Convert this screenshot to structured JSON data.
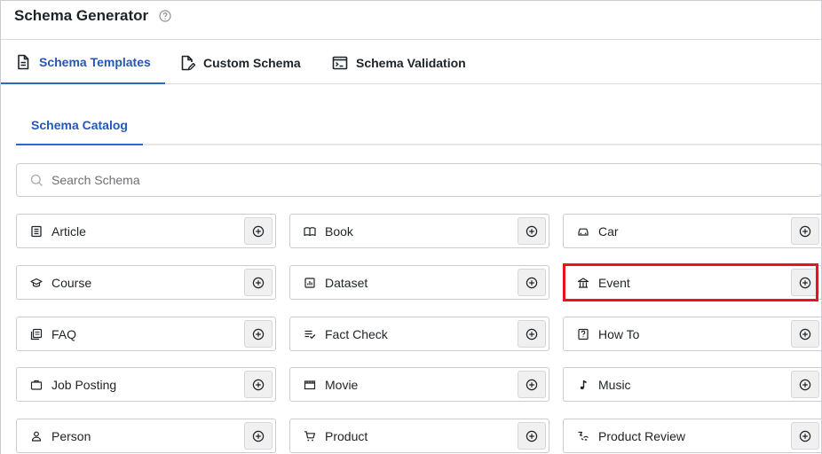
{
  "app": {
    "title": "Schema Generator"
  },
  "tabs": [
    {
      "label": "Schema Templates",
      "icon": "document-icon",
      "active": true
    },
    {
      "label": "Custom Schema",
      "icon": "document-edit-icon",
      "active": false
    },
    {
      "label": "Schema Validation",
      "icon": "terminal-icon",
      "active": false
    }
  ],
  "subtabs": [
    {
      "label": "Schema Catalog",
      "active": true
    }
  ],
  "search": {
    "placeholder": "Search Schema",
    "value": ""
  },
  "catalog": [
    {
      "label": "Article",
      "icon": "article-icon"
    },
    {
      "label": "Book",
      "icon": "book-icon"
    },
    {
      "label": "Car",
      "icon": "car-icon"
    },
    {
      "label": "Course",
      "icon": "graduation-cap-icon"
    },
    {
      "label": "Dataset",
      "icon": "dataset-icon"
    },
    {
      "label": "Event",
      "icon": "event-venue-icon",
      "highlighted": true
    },
    {
      "label": "FAQ",
      "icon": "faq-icon"
    },
    {
      "label": "Fact Check",
      "icon": "fact-check-icon"
    },
    {
      "label": "How To",
      "icon": "how-to-icon"
    },
    {
      "label": "Job Posting",
      "icon": "briefcase-icon"
    },
    {
      "label": "Movie",
      "icon": "movie-icon"
    },
    {
      "label": "Music",
      "icon": "music-note-icon"
    },
    {
      "label": "Person",
      "icon": "person-icon"
    },
    {
      "label": "Product",
      "icon": "cart-icon"
    },
    {
      "label": "Product Review",
      "icon": "review-icon"
    }
  ],
  "colors": {
    "accent": "#2358b8",
    "highlight": "#e8141d",
    "border": "#c9ccd1"
  }
}
